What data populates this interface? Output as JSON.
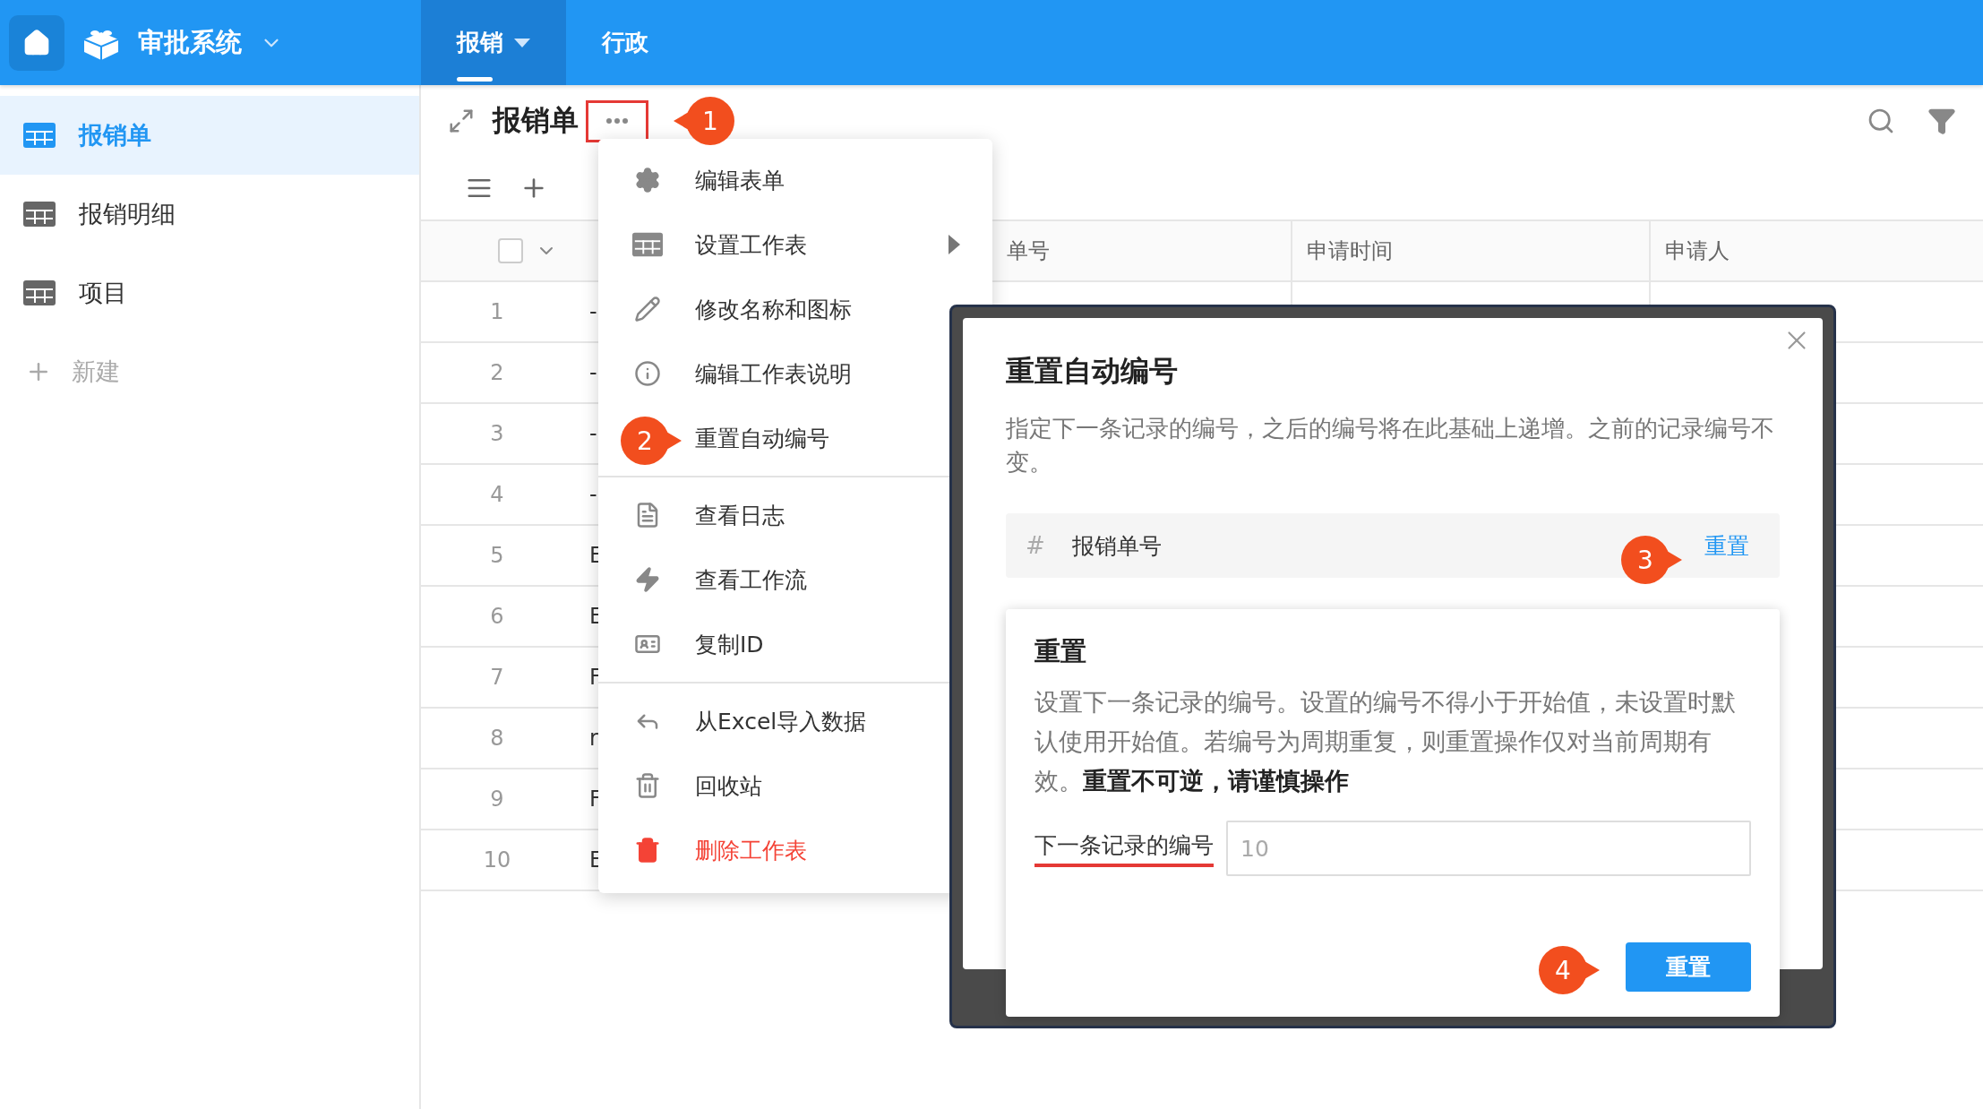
{
  "app": {
    "title": "审批系统"
  },
  "nav_tabs": [
    {
      "label": "报销",
      "selected": true,
      "has_dropdown": true
    },
    {
      "label": "行政",
      "selected": false,
      "has_dropdown": false
    }
  ],
  "sidebar": {
    "items": [
      {
        "label": "报销单",
        "selected": true
      },
      {
        "label": "报销明细",
        "selected": false
      },
      {
        "label": "项目",
        "selected": false
      }
    ],
    "new_label": "新建"
  },
  "sheet": {
    "title": "报销单",
    "more_highlighted": true
  },
  "table": {
    "select_all_checked": false,
    "columns": [
      "单号",
      "申请时间",
      "申请人"
    ],
    "rows": [
      {
        "number": "1",
        "column_2": "-"
      },
      {
        "number": "2",
        "column_2": "-"
      },
      {
        "number": "3",
        "column_2": "-"
      },
      {
        "number": "4",
        "column_2": "-"
      },
      {
        "number": "5",
        "column_2": "E"
      },
      {
        "number": "6",
        "column_2": "E"
      },
      {
        "number": "7",
        "column_2": "F"
      },
      {
        "number": "8",
        "column_2": "r"
      },
      {
        "number": "9",
        "column_2": "F"
      },
      {
        "number": "10",
        "column_2": "E"
      }
    ]
  },
  "context_menu": {
    "items": [
      {
        "kind": "item",
        "label": "编辑表单",
        "submenu": false,
        "danger": false
      },
      {
        "kind": "item",
        "label": "设置工作表",
        "submenu": true,
        "danger": false
      },
      {
        "kind": "item",
        "label": "修改名称和图标",
        "submenu": false,
        "danger": false
      },
      {
        "kind": "item",
        "label": "编辑工作表说明",
        "submenu": false,
        "danger": false
      },
      {
        "kind": "item",
        "label": "重置自动编号",
        "submenu": false,
        "danger": false
      },
      {
        "kind": "divider"
      },
      {
        "kind": "item",
        "label": "查看日志",
        "submenu": false,
        "danger": false
      },
      {
        "kind": "item",
        "label": "查看工作流",
        "submenu": false,
        "danger": false
      },
      {
        "kind": "item",
        "label": "复制ID",
        "submenu": false,
        "danger": false
      },
      {
        "kind": "divider"
      },
      {
        "kind": "item",
        "label": "从Excel导入数据",
        "submenu": false,
        "danger": false
      },
      {
        "kind": "item",
        "label": "回收站",
        "submenu": false,
        "danger": false
      },
      {
        "kind": "item",
        "label": "删除工作表",
        "submenu": false,
        "danger": true
      }
    ]
  },
  "dialog": {
    "title": "重置自动编号",
    "description": "指定下一条记录的编号，之后的编号将在此基础上递增。之前的记录编号不变。",
    "field": {
      "symbol": "#",
      "name": "报销单号",
      "action": "重置"
    },
    "popover": {
      "title": "重置",
      "description": "设置下一条记录的编号。设置的编号不得小于开始值，未设置时默认使用开始值。若编号为周期重复，则重置操作仅对当前周期有效。**重置不可逆，请谨慎操作**",
      "input_label": "下一条记录的编号",
      "label_underlined": true,
      "input_placeholder": "10",
      "button": "重置"
    }
  },
  "callouts": [
    {
      "number": "1"
    },
    {
      "number": "2"
    },
    {
      "number": "3"
    },
    {
      "number": "4"
    }
  ]
}
